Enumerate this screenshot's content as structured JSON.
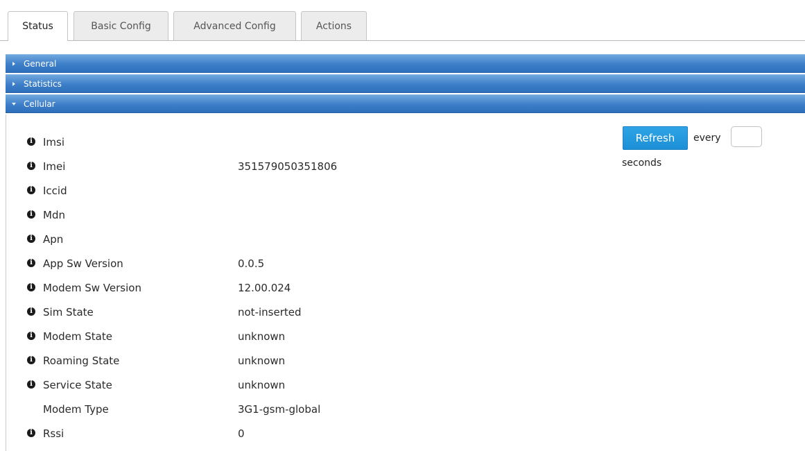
{
  "tabs": [
    {
      "label": "Status",
      "active": true
    },
    {
      "label": "Basic Config",
      "active": false
    },
    {
      "label": "Advanced Config",
      "active": false
    },
    {
      "label": "Actions",
      "active": false
    }
  ],
  "sections": [
    {
      "label": "General",
      "expanded": false
    },
    {
      "label": "Statistics",
      "expanded": false
    },
    {
      "label": "Cellular",
      "expanded": true
    }
  ],
  "cellular": {
    "rows": [
      {
        "label": "Imsi",
        "value": "",
        "info": true
      },
      {
        "label": "Imei",
        "value": "351579050351806",
        "info": true
      },
      {
        "label": "Iccid",
        "value": "",
        "info": true
      },
      {
        "label": "Mdn",
        "value": "",
        "info": true
      },
      {
        "label": "Apn",
        "value": "",
        "info": true
      },
      {
        "label": "App Sw Version",
        "value": "0.0.5",
        "info": true
      },
      {
        "label": "Modem Sw Version",
        "value": "12.00.024",
        "info": true
      },
      {
        "label": "Sim State",
        "value": "not-inserted",
        "info": true
      },
      {
        "label": "Modem State",
        "value": "unknown",
        "info": true
      },
      {
        "label": "Roaming State",
        "value": "unknown",
        "info": true
      },
      {
        "label": "Service State",
        "value": "unknown",
        "info": true
      },
      {
        "label": "Modem Type",
        "value": "3G1-gsm-global",
        "info": false
      },
      {
        "label": "Rssi",
        "value": "0",
        "info": true
      }
    ]
  },
  "refresh": {
    "button_label": "Refresh",
    "every_label": "every",
    "interval_value": "",
    "seconds_label": "seconds"
  },
  "colors": {
    "accordion_header": "#3d7ec8",
    "refresh_button": "#1c8fd6"
  }
}
